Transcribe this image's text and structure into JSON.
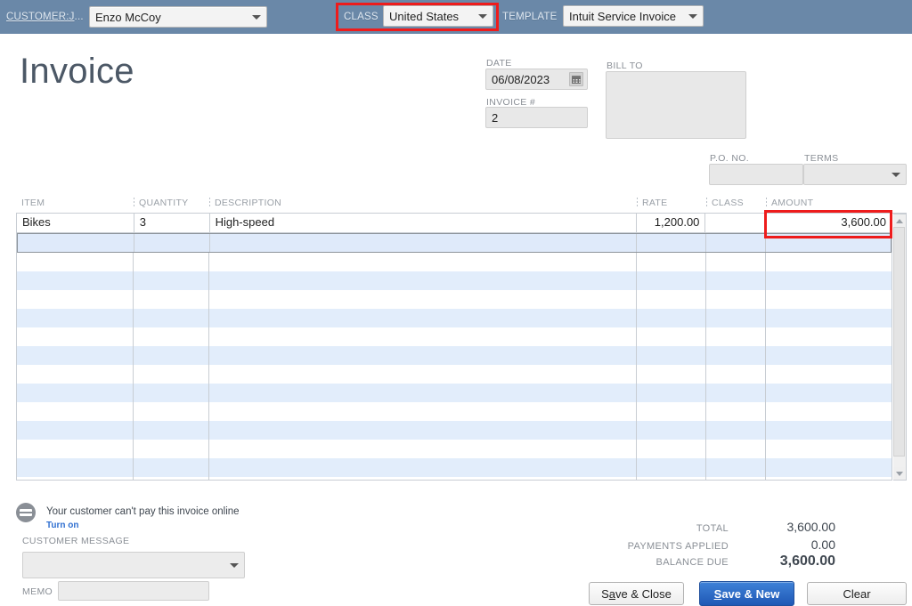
{
  "topbar": {
    "customer_label": "CUSTOMER:J",
    "customer_label_suffix": "...",
    "customer_value": "Enzo McCoy",
    "class_label": "CLASS",
    "class_value": "United States",
    "template_label": "TEMPLATE",
    "template_value": "Intuit Service Invoice",
    "background_color": "#6a88a8"
  },
  "form": {
    "title": "Invoice",
    "date_label": "DATE",
    "date_value": "06/08/2023",
    "invoice_no_label": "INVOICE #",
    "invoice_no_value": "2",
    "bill_to_label": "BILL TO",
    "bill_to_value": "",
    "po_label": "P.O. NO.",
    "po_value": "",
    "terms_label": "TERMS",
    "terms_value": ""
  },
  "grid": {
    "columns": [
      "ITEM",
      "QUANTITY",
      "DESCRIPTION",
      "RATE",
      "CLASS",
      "AMOUNT"
    ],
    "rows": [
      {
        "item": "Bikes",
        "quantity": "3",
        "description": "High-speed",
        "rate": "1,200.00",
        "class": "",
        "amount": "3,600.00"
      }
    ],
    "empty_row_count": 13
  },
  "pay_notice": {
    "text": "Your customer can't pay this invoice online",
    "link": "Turn on"
  },
  "bottom": {
    "customer_message_label": "CUSTOMER MESSAGE",
    "customer_message_value": "",
    "memo_label": "MEMO",
    "memo_value": ""
  },
  "totals": {
    "total_label": "TOTAL",
    "total_value": "3,600.00",
    "payments_label": "PAYMENTS APPLIED",
    "payments_value": "0.00",
    "balance_label": "BALANCE DUE",
    "balance_value": "3,600.00"
  },
  "buttons": {
    "save_close_prefix": "S",
    "save_close_accel": "a",
    "save_close_suffix": "ve & Close",
    "save_new_accel": "S",
    "save_new_suffix": "ave & New",
    "clear": "Clear"
  },
  "highlights": {
    "accent_color": "#ee1c1c",
    "primary_button_color": "#2a63be"
  }
}
